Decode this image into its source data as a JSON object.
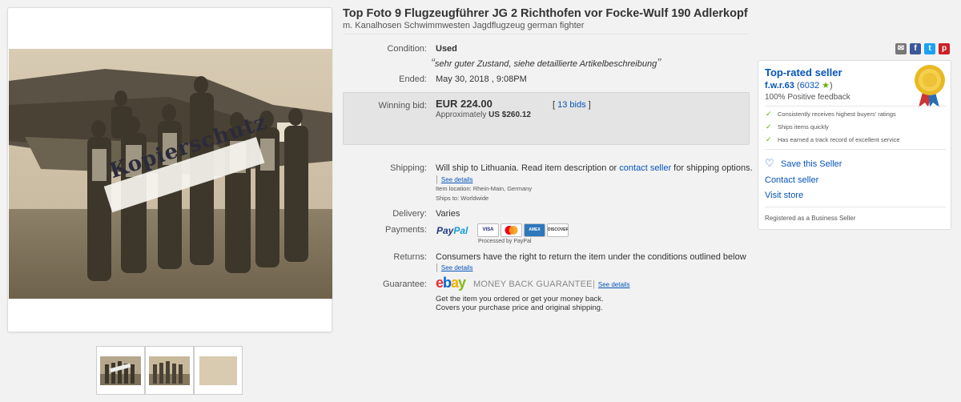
{
  "listing": {
    "title": "Top Foto 9 Flugzeugführer JG 2 Richthofen vor Focke-Wulf 190 Adlerkopf",
    "subtitle": "m. Kanalhosen Schwimmwesten Jagdflugzeug german fighter"
  },
  "image": {
    "watermark": "Kopierschutz",
    "thumbnail_count": 3
  },
  "condition": {
    "label": "Condition:",
    "value": "Used",
    "quote_open": "“",
    "note": "sehr guter Zustand, siehe detaillierte Artikelbeschreibung",
    "quote_close": "”"
  },
  "ended": {
    "label": "Ended:",
    "value": "May 30, 2018 , 9:08PM"
  },
  "bid": {
    "label": "Winning bid:",
    "amount": "EUR 224.00",
    "approx_prefix": "Approximately",
    "approx_value": "US $260.12",
    "bids_bracket_open": "[",
    "bids_link": "13 bids",
    "bids_bracket_close": "]"
  },
  "shipping": {
    "label": "Shipping:",
    "text_before": "Will ship to Lithuania. Read item description or",
    "contact_link": "contact seller",
    "text_after": "for shipping options.",
    "bar": "|",
    "see_details": "See details",
    "location_label": "Item location:",
    "location": "Rhein-Main, Germany",
    "ships_to_label": "Ships to:",
    "ships_to": "Worldwide"
  },
  "delivery": {
    "label": "Delivery:",
    "value": "Varies"
  },
  "payments": {
    "label": "Payments:",
    "paypal_pay": "Pay",
    "paypal_pal": "Pal",
    "cards": [
      "VISA",
      "MC",
      "AMEX",
      "DISCOVER"
    ],
    "processed": "Processed by PayPal"
  },
  "returns": {
    "label": "Returns:",
    "text": "Consumers have the right to return the item under the conditions outlined below",
    "bar": "|",
    "see_details": "See details"
  },
  "guarantee": {
    "label": "Guarantee:",
    "logo": {
      "e": "e",
      "b": "b",
      "a": "a",
      "y": "y"
    },
    "mbg": "MONEY BACK GUARANTEE",
    "bar": "|",
    "see_details": "See details",
    "line1": "Get the item you ordered or get your money back.",
    "line2": "Covers your purchase price and original shipping."
  },
  "seller": {
    "badge_title": "Top-rated seller",
    "username": "f.w.r.63",
    "feedback_open": "(",
    "feedback_score": "6032",
    "feedback_close": ")",
    "positive": "100% Positive feedback",
    "features": [
      "Consistently receives highest buyers' ratings",
      "Ships items quickly",
      "Has earned a track record of excellent service"
    ],
    "save": "Save this Seller",
    "contact": "Contact seller",
    "visit": "Visit store",
    "registered": "Registered as a Business Seller"
  },
  "share_icons": [
    "email-icon",
    "facebook-icon",
    "twitter-icon",
    "pinterest-icon"
  ],
  "colors": {
    "link": "#0654ba",
    "badge_title": "#0654ba",
    "paypal_dark": "#253b80",
    "paypal_light": "#179bd7",
    "ebay_e": "#e53238",
    "ebay_b": "#0064d2",
    "ebay_a": "#f5af02",
    "ebay_y": "#86b817"
  }
}
